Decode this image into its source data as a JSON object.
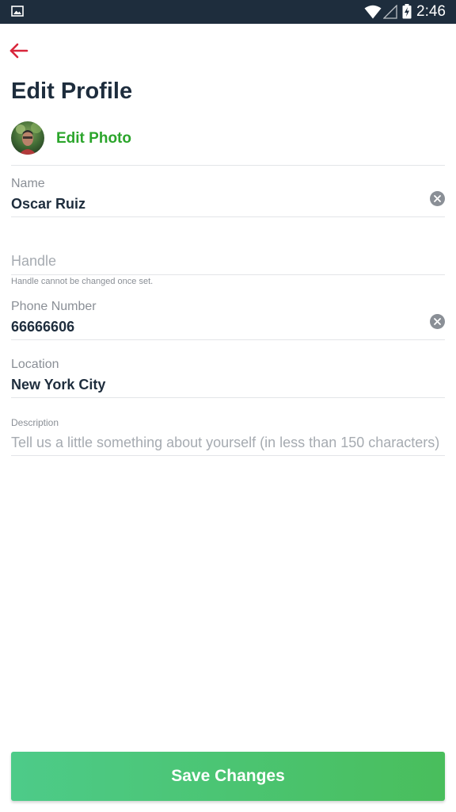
{
  "status_bar": {
    "time": "2:46",
    "icons": [
      "gallery-icon",
      "wifi-icon",
      "signal-icon",
      "battery-charging-icon"
    ]
  },
  "header": {
    "back_icon": "arrow-left-icon",
    "title": "Edit Profile"
  },
  "photo": {
    "edit_label": "Edit Photo"
  },
  "form": {
    "name": {
      "label": "Name",
      "value": "Oscar Ruiz"
    },
    "handle": {
      "placeholder": "Handle",
      "helper": "Handle cannot be changed once set."
    },
    "phone": {
      "label": "Phone Number",
      "value": "66666606"
    },
    "location": {
      "label": "Location",
      "value": "New York City"
    },
    "description": {
      "label": "Description",
      "placeholder": "Tell us a little something about yourself (in less than 150 characters)"
    }
  },
  "footer": {
    "save_label": "Save Changes"
  },
  "colors": {
    "accent_green": "#2ba52b",
    "back_arrow_red": "#d8263b",
    "title_dark": "#1e2d3d",
    "status_bar": "#1e2d3d"
  }
}
